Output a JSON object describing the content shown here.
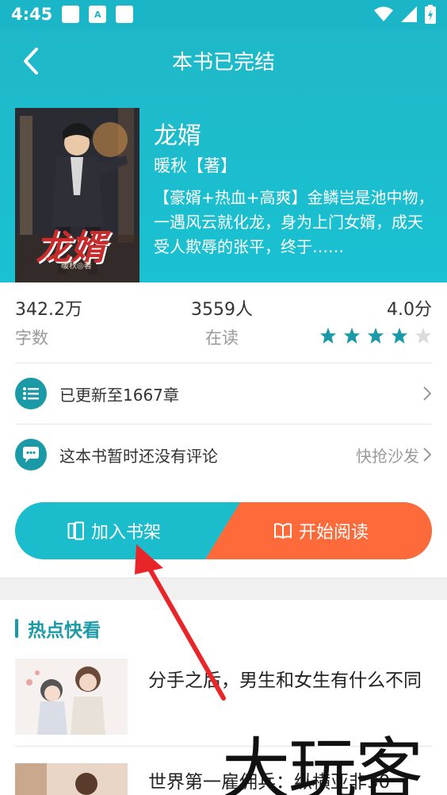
{
  "status_bar": {
    "time": "4:45"
  },
  "topbar": {
    "title": "本书已完结"
  },
  "book": {
    "cover_title": "龙婿",
    "cover_author": "暖秋◎著",
    "name": "龙婿",
    "author": "暖秋【著】",
    "description": "【豪婿+热血+高爽】金鳞岂是池中物，一遇风云就化龙，身为上门女婿，成天受人欺辱的张平，终于……"
  },
  "stats": {
    "words_value": "342.2万",
    "words_label": "字数",
    "readers_value": "3559人",
    "readers_label": "在读",
    "score_value": "4.0分",
    "rating_stars": 4,
    "rating_max": 5
  },
  "rows": {
    "chapters_text": "已更新至1667章",
    "comments_text": "这本书暂时还没有评论",
    "comments_action": "快抢沙发"
  },
  "actions": {
    "shelf_label": "加入书架",
    "read_label": "开始阅读"
  },
  "section": {
    "title": "热点快看",
    "items": [
      {
        "title": "分手之后，男生和女生有什么不同"
      },
      {
        "title": "世界第一雇佣兵：纵横亚非30"
      }
    ]
  },
  "watermark": "大玩客",
  "colors": {
    "accent": "#1bb5c8",
    "accent_dark": "#1a9aa6",
    "orange": "#ff6a3a",
    "arrow": "#e8262a"
  }
}
